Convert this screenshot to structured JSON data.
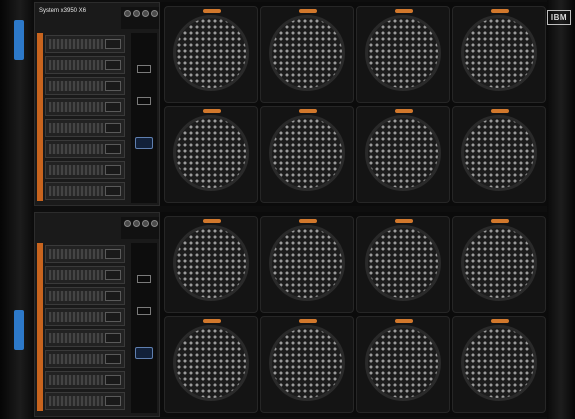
{
  "device": {
    "brand_logo": "IBM",
    "model_label": "System x3950 X6",
    "accent_color": "#c8641e",
    "fan_tab_color": "#d2782c",
    "blue_tab_color": "#2d79c9"
  },
  "nodes": [
    {
      "id": "upper",
      "drive_count": 8,
      "icons": [
        "power-icon",
        "usb-icon",
        "usb-icon",
        "vga-icon"
      ]
    },
    {
      "id": "lower",
      "drive_count": 8,
      "icons": [
        "power-icon",
        "usb-icon",
        "usb-icon",
        "vga-icon"
      ]
    }
  ],
  "fans": {
    "columns": 4,
    "rows_per_node": 2
  }
}
